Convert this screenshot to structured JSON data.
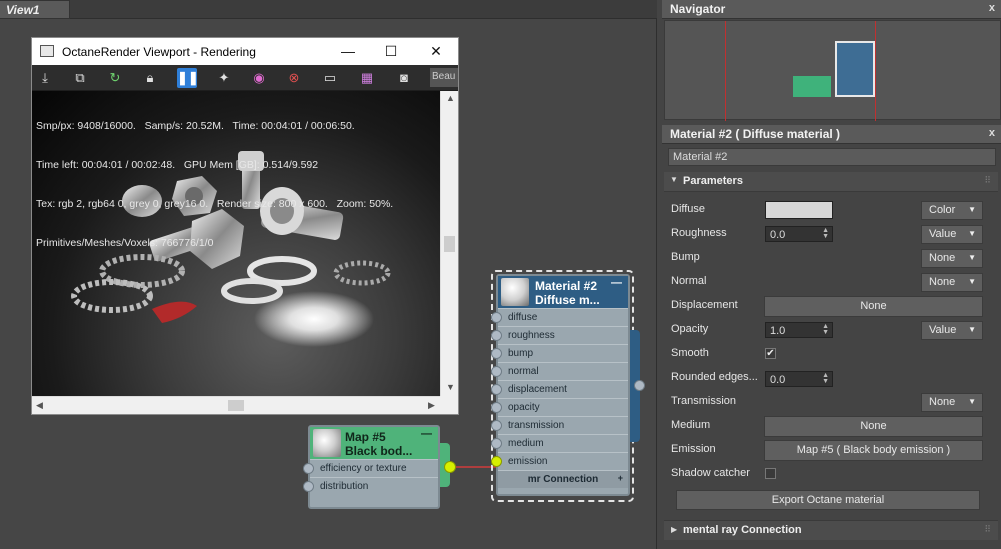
{
  "view": {
    "title": "View1"
  },
  "octane_window": {
    "title": "OctaneRender Viewport - Rendering",
    "toolbar_dropdown": "Beau",
    "stats": [
      "Smp/px: 9408/16000.   Samp/s: 20.52M.   Time: 00:04:01 / 00:06:50.",
      "Time left: 00:04:01 / 00:02:48.   GPU Mem [GB]: 0.514/9.592",
      "Tex: rgb 2, rgb64 0, grey 0, grey16 0.   Render size: 800 x 600.   Zoom: 50%.",
      "Primitives/Meshes/Voxels: 766776/1/0"
    ]
  },
  "material_node": {
    "title_line1": "Material #2",
    "title_line2": "Diffuse m...",
    "slots": [
      "diffuse",
      "roughness",
      "bump",
      "normal",
      "displacement",
      "opacity",
      "transmission",
      "medium",
      "emission"
    ],
    "footer": "mr Connection"
  },
  "map_node": {
    "title_line1": "Map #5",
    "title_line2": "Black bod...",
    "slots": [
      "efficiency or texture",
      "distribution"
    ]
  },
  "navigator": {
    "title": "Navigator"
  },
  "material_panel": {
    "title": "Material #2  ( Diffuse material )",
    "name_value": "Material #2",
    "section": "Parameters",
    "diffuse": {
      "label": "Diffuse",
      "swatch": "#d8d8d8",
      "mode": "Color"
    },
    "roughness": {
      "label": "Roughness",
      "value": "0.0",
      "mode": "Value"
    },
    "bump": {
      "label": "Bump",
      "mode": "None"
    },
    "normal": {
      "label": "Normal",
      "mode": "None"
    },
    "displacement": {
      "label": "Displacement",
      "button": "None"
    },
    "opacity": {
      "label": "Opacity",
      "value": "1.0",
      "mode": "Value"
    },
    "smooth": {
      "label": "Smooth",
      "checked": "✔"
    },
    "rounded_edges": {
      "label": "Rounded edges...",
      "value": "0.0"
    },
    "transmission": {
      "label": "Transmission",
      "mode": "None"
    },
    "medium": {
      "label": "Medium",
      "button": "None"
    },
    "emission": {
      "label": "Emission",
      "button": "Map #5  ( Black body emission )"
    },
    "shadow_catcher": {
      "label": "Shadow catcher"
    },
    "export_button": "Export Octane material",
    "mr_section": "mental ray Connection"
  },
  "colors": {
    "node_header": "#2e5d84",
    "map_thumb_green": "#4fb37a",
    "nav_blue": "#3e6d94",
    "nav_green": "#3fb27b",
    "wire": "#d23b3b",
    "socket_active": "#d6f000"
  }
}
